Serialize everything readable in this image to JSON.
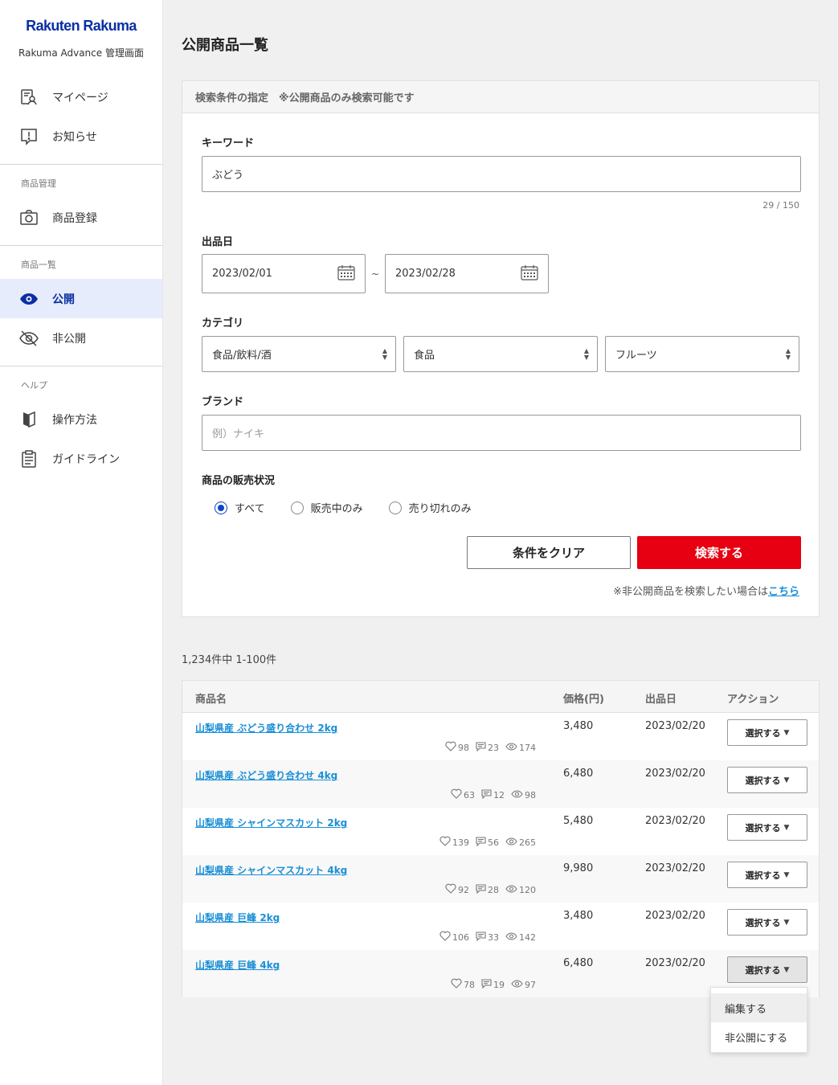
{
  "brand": {
    "logo": "Rakuten Rakuma",
    "subtitle": "Rakuma Advance 管理画面"
  },
  "sidebar": {
    "top_items": [
      {
        "label": "マイページ",
        "icon": "mypage-icon"
      },
      {
        "label": "お知らせ",
        "icon": "notice-icon"
      }
    ],
    "section_product_mgmt": "商品管理",
    "product_mgmt_items": [
      {
        "label": "商品登録",
        "icon": "camera-icon"
      }
    ],
    "section_product_list": "商品一覧",
    "product_list_items": [
      {
        "label": "公開",
        "icon": "eye-icon",
        "active": true
      },
      {
        "label": "非公開",
        "icon": "eye-off-icon"
      }
    ],
    "section_help": "ヘルプ",
    "help_items": [
      {
        "label": "操作方法",
        "icon": "book-icon"
      },
      {
        "label": "ガイドライン",
        "icon": "clipboard-icon"
      }
    ]
  },
  "page": {
    "title": "公開商品一覧"
  },
  "search": {
    "header": "検索条件の指定　※公開商品のみ検索可能です",
    "keyword_label": "キーワード",
    "keyword_value": "ぶどう",
    "keyword_counter": "29 / 150",
    "date_label": "出品日",
    "date_from": "2023/02/01",
    "date_to": "2023/02/28",
    "date_sep": "~",
    "category_label": "カテゴリ",
    "category_1": "食品/飲料/酒",
    "category_2": "食品",
    "category_3": "フルーツ",
    "brand_label": "ブランド",
    "brand_placeholder": "例）ナイキ",
    "status_label": "商品の販売状況",
    "status_options": [
      "すべて",
      "販売中のみ",
      "売り切れのみ"
    ],
    "status_selected": "すべて",
    "clear_button": "条件をクリア",
    "search_button": "検索する",
    "hidden_note": "※非公開商品を検索したい場合は",
    "hidden_link": "こちら"
  },
  "results": {
    "count_text": "1,234件中 1-100件",
    "headers": {
      "name": "商品名",
      "price": "価格(円)",
      "date": "出品日",
      "action": "アクション"
    },
    "rows": [
      {
        "name": "山梨県産 ぶどう盛り合わせ 2kg",
        "likes": "98",
        "comments": "23",
        "views": "174",
        "price": "3,480",
        "date": "2023/02/20",
        "action": "選択する"
      },
      {
        "name": "山梨県産 ぶどう盛り合わせ 4kg",
        "likes": "63",
        "comments": "12",
        "views": "98",
        "price": "6,480",
        "date": "2023/02/20",
        "action": "選択する"
      },
      {
        "name": "山梨県産 シャインマスカット 2kg",
        "likes": "139",
        "comments": "56",
        "views": "265",
        "price": "5,480",
        "date": "2023/02/20",
        "action": "選択する"
      },
      {
        "name": "山梨県産 シャインマスカット 4kg",
        "likes": "92",
        "comments": "28",
        "views": "120",
        "price": "9,980",
        "date": "2023/02/20",
        "action": "選択する"
      },
      {
        "name": "山梨県産 巨峰 2kg",
        "likes": "106",
        "comments": "33",
        "views": "142",
        "price": "3,480",
        "date": "2023/02/20",
        "action": "選択する"
      },
      {
        "name": "山梨県産 巨峰 4kg",
        "likes": "78",
        "comments": "19",
        "views": "97",
        "price": "6,480",
        "date": "2023/02/20",
        "action": "選択する"
      }
    ],
    "action_menu": [
      "編集する",
      "非公開にする"
    ]
  },
  "colors": {
    "brand_blue": "#0a2fa3",
    "search_red": "#e60012",
    "link_blue": "#1a8fd6",
    "active_bg": "#e6ecfb"
  }
}
